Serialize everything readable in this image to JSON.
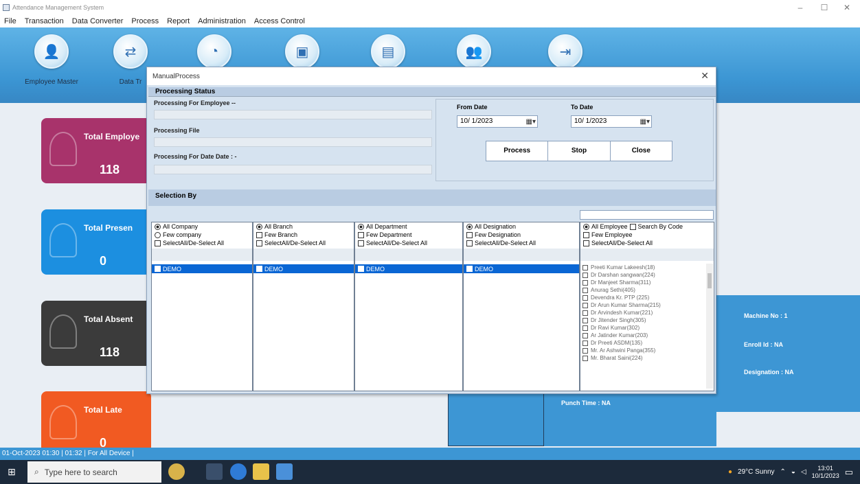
{
  "window": {
    "title": "Attendance Management System",
    "min": "–",
    "max": "☐",
    "close": "✕"
  },
  "menu": [
    "File",
    "Transaction",
    "Data Converter",
    "Process",
    "Report",
    "Administration",
    "Access Control"
  ],
  "ribbon": {
    "buttons": [
      {
        "label": "Employee Master",
        "icon": "employee-icon",
        "glyph": "👤"
      },
      {
        "label": "Data Tr",
        "icon": "data-transfer-icon",
        "glyph": "⇄"
      },
      {
        "label": "",
        "icon": "report-chart-icon",
        "glyph": "◔"
      },
      {
        "label": "",
        "icon": "device-icon",
        "glyph": "▣"
      },
      {
        "label": "",
        "icon": "document-icon",
        "glyph": "▤"
      },
      {
        "label": "",
        "icon": "users-icon",
        "glyph": "👥"
      },
      {
        "label": "",
        "icon": "exit-icon",
        "glyph": "⇥"
      }
    ]
  },
  "cards": [
    {
      "title": "Total Employe",
      "value": "118",
      "color": "#a8336b"
    },
    {
      "title": "Total Presen",
      "value": "0",
      "color": "#1c8fe0"
    },
    {
      "title": "Total Absent",
      "value": "118",
      "color": "#3b3b3b"
    },
    {
      "title": "Total Late",
      "value": "0",
      "color": "#f15a22"
    }
  ],
  "right_panel": {
    "machine": "Machine No : 1",
    "enroll": "Enroll Id : NA",
    "designation": "Designation : NA",
    "punch": "Punch Time : NA"
  },
  "status_bar": "01-Oct-2023 01:30 |   01:32 |   For All Device |",
  "taskbar": {
    "search_placeholder": "Type here to search",
    "weather": "29°C Sunny",
    "time": "13:01",
    "date": "10/1/2023"
  },
  "dialog": {
    "title": "ManualProcess",
    "close": "✕",
    "processing_status": "Processing Status",
    "processing_employee": "Processing For Employee --",
    "processing_file": "Processing File",
    "processing_date": "Processing For Date    Date : -",
    "from_date_label": "From Date",
    "to_date_label": "To Date",
    "from_date": "10/ 1/2023",
    "to_date": "10/ 1/2023",
    "buttons": {
      "process": "Process",
      "stop": "Stop",
      "close": "Close"
    },
    "selection_by": "Selection By",
    "columns": [
      {
        "all": "All Company",
        "few": "Few company",
        "select_all": "SelectAll/De-Select All",
        "selected": "DEMO"
      },
      {
        "all": "All Branch",
        "few": "Few Branch",
        "select_all": "SelectAll/De-Select All",
        "selected": "DEMO"
      },
      {
        "all": "All Department",
        "few": "Few Department",
        "select_all": "SelectAll/De-Select All",
        "selected": "DEMO"
      },
      {
        "all": "All Designation",
        "few": "Few Designation",
        "select_all": "SelectAll/De-Select All",
        "selected": "DEMO"
      }
    ],
    "employee_column": {
      "all": "All Employee",
      "search_by_code": "Search By Code",
      "few": "Few Employee",
      "select_all": "SelectAll/De-Select All",
      "employees": [
        "Preeti Kumar Lakeesh(18)",
        "Dr Darshan sangwan(224)",
        "Dr Manjeet Sharma(311)",
        "Anurag Sethi(405)",
        "Devendra Kr. PTP (225)",
        "Dr Arun Kumar Sharma(215)",
        "Dr Arvindesh Kumar(221)",
        "Dr Jitender Singh(305)",
        "Dr Ravi Kumar(302)",
        "Ar Jatinder Kumar(203)",
        "Dr Preeti ASDM(135)",
        "Mr. Ar Ashwini Panga(355)",
        "Mr. Bharat Saini(224)"
      ]
    }
  }
}
